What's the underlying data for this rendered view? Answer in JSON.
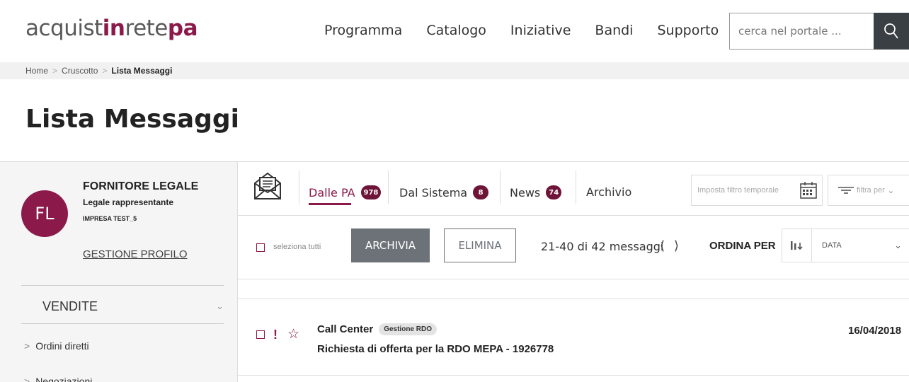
{
  "header": {
    "logo_prefix": "acquist",
    "logo_brand1": "in",
    "logo_mid": "rete",
    "logo_brand2": "pa",
    "nav": [
      "Programma",
      "Catalogo",
      "Iniziative",
      "Bandi",
      "Supporto"
    ],
    "search_placeholder": "cerca nel portale ..."
  },
  "breadcrumb": {
    "items": [
      "Home",
      "Cruscotto"
    ],
    "current": "Lista Messaggi"
  },
  "page_title": "Lista Messaggi",
  "sidebar": {
    "avatar_initials": "FL",
    "user_name": "FORNITORE LEGALE",
    "user_role": "Legale rappresentante",
    "user_company": "IMPRESA TEST_5",
    "profile_link": "GESTIONE PROFILO",
    "section_title": "VENDITE",
    "items": [
      {
        "label": "Ordini diretti"
      },
      {
        "label": "Negoziazioni"
      }
    ]
  },
  "tabs": [
    {
      "label": "Dalle PA",
      "badge": "978",
      "active": true
    },
    {
      "label": "Dal Sistema",
      "badge": "8"
    },
    {
      "label": "News",
      "badge": "74"
    },
    {
      "label": "Archivio"
    }
  ],
  "filters": {
    "date_placeholder": "Imposta filtro temporale",
    "filter_by": "filtra per"
  },
  "toolbar": {
    "select_all": "seleziona tutti",
    "archive_label": "ARCHIVIA",
    "delete_label": "ELIMINA",
    "count": "21-40 di 42 messaggi",
    "sort_label": "ORDINA PER",
    "sort_value": "DATA"
  },
  "messages": [
    {
      "sender": "Call Center",
      "tag": "Gestione RDO",
      "subject": "Richiesta di offerta per la RDO MEPA - 1926778",
      "date": "16/04/2018"
    }
  ],
  "colors": {
    "brand": "#8b1a4a",
    "badge": "#6e1438",
    "button_dark": "#6d7278",
    "search_button": "#3a3f44"
  }
}
